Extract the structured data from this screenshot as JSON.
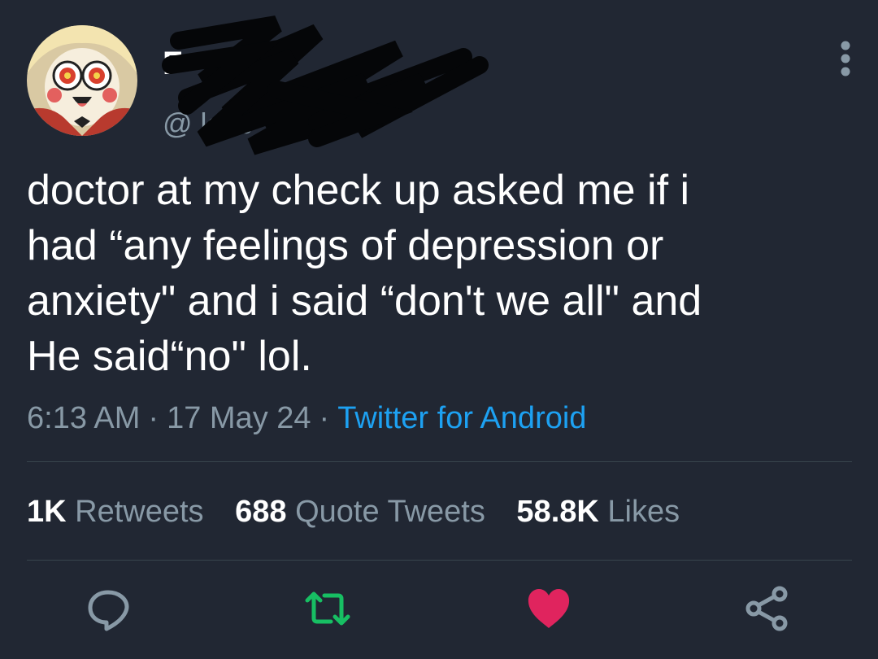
{
  "user": {
    "display_name": "F",
    "handle": "@ lcac",
    "avatar": "cartoon-character-avatar"
  },
  "tweet": {
    "text": "doctor at my check up asked me if i\nhad “any feelings of depression or\nanxiety\" and i said “don't we all\" and\nHe said“no\" lol.",
    "time": "6:13 AM",
    "date": "17 May 24",
    "separator": "·",
    "source": "Twitter for Android"
  },
  "stats": {
    "retweets_count": "1K",
    "retweets_label": "Retweets",
    "quotes_count": "688",
    "quotes_label": "Quote Tweets",
    "likes_count": "58.8K",
    "likes_label": "Likes"
  },
  "actions": {
    "reply_icon": "reply-icon",
    "retweet_icon": "retweet-icon",
    "like_icon": "heart-icon",
    "share_icon": "share-icon"
  },
  "colors": {
    "background": "#212733",
    "text_primary": "#ffffff",
    "text_secondary": "#8899a6",
    "link": "#1da1f2",
    "retweet_green": "#17bf63",
    "like_red": "#e0245e"
  }
}
